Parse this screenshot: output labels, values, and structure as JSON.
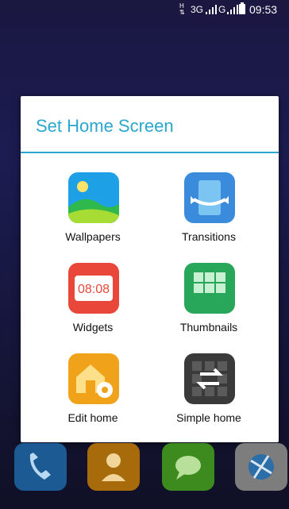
{
  "status_bar": {
    "network_1": "3G",
    "network_2": "G",
    "time": "09:53"
  },
  "dialog": {
    "title": "Set Home Screen",
    "items": [
      {
        "label": "Wallpapers",
        "icon": "wallpapers-icon"
      },
      {
        "label": "Transitions",
        "icon": "transitions-icon"
      },
      {
        "label": "Widgets",
        "icon": "widgets-icon",
        "icon_text": "08:08"
      },
      {
        "label": "Thumbnails",
        "icon": "thumbnails-icon"
      },
      {
        "label": "Edit home",
        "icon": "edit-home-icon"
      },
      {
        "label": "Simple home",
        "icon": "simple-home-icon"
      }
    ]
  },
  "dock": {
    "apps": [
      "phone-icon",
      "contacts-icon",
      "messages-icon",
      "browser-icon"
    ]
  },
  "colors": {
    "accent": "#2aa6cf",
    "wallpaper_top": "#1a1740",
    "wallpaper_bottom": "#101026"
  }
}
